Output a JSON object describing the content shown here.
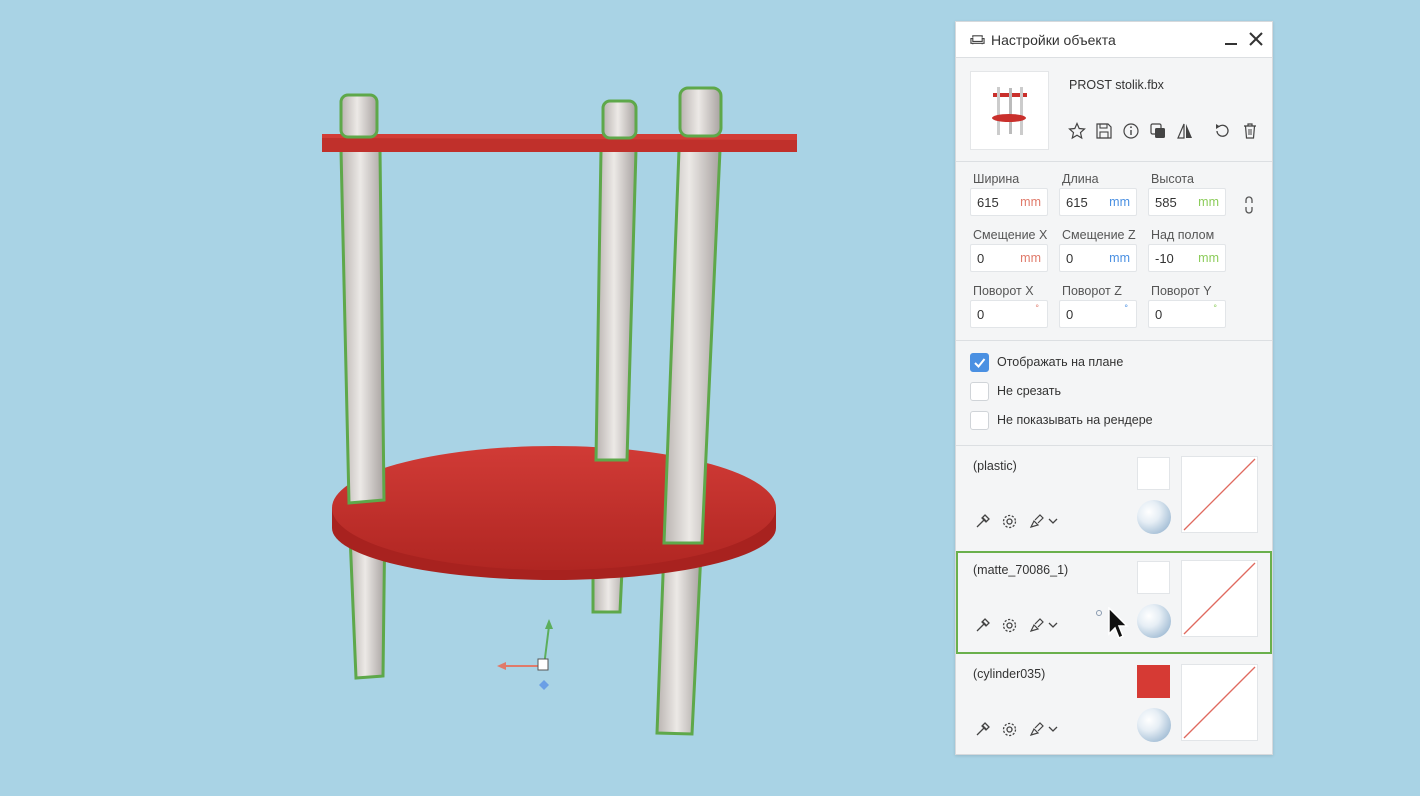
{
  "panel": {
    "title": "Настройки объекта",
    "file_name": "PROST stolik.fbx"
  },
  "dimensions": {
    "width": {
      "label": "Ширина",
      "value": "615",
      "unit": "mm",
      "unit_color": "#e07a6a"
    },
    "length": {
      "label": "Длина",
      "value": "615",
      "unit": "mm",
      "unit_color": "#4a90e2"
    },
    "height": {
      "label": "Высота",
      "value": "585",
      "unit": "mm",
      "unit_color": "#8ccc5a"
    }
  },
  "offsets": {
    "x": {
      "label": "Смещение X",
      "value": "0",
      "unit": "mm",
      "unit_color": "#e07a6a"
    },
    "z": {
      "label": "Смещение Z",
      "value": "0",
      "unit": "mm",
      "unit_color": "#4a90e2"
    },
    "floor": {
      "label": "Над полом",
      "value": "-10",
      "unit": "mm",
      "unit_color": "#8ccc5a"
    }
  },
  "rotation": {
    "x": {
      "label": "Поворот X",
      "value": "0",
      "unit": "°",
      "unit_color": "#e07a6a"
    },
    "z": {
      "label": "Поворот Z",
      "value": "0",
      "unit": "°",
      "unit_color": "#4a90e2"
    },
    "y": {
      "label": "Поворот Y",
      "value": "0",
      "unit": "°",
      "unit_color": "#8ccc5a"
    }
  },
  "options": [
    {
      "label": "Отображать на плане",
      "checked": true
    },
    {
      "label": "Не срезать",
      "checked": false
    },
    {
      "label": "Не показывать на рендере",
      "checked": false
    }
  ],
  "materials": [
    {
      "name": "(plastic)",
      "color": "#ffffff",
      "selected": false
    },
    {
      "name": "(matte_70086_1)",
      "color": "#ffffff",
      "selected": true
    },
    {
      "name": "(cylinder035)",
      "color": "#d63a34",
      "selected": false
    }
  ],
  "colors": {
    "accent": "#4a90e2",
    "selection": "#6ab04c",
    "table_red": "#c92a2a",
    "background": "#a9d3e5"
  }
}
